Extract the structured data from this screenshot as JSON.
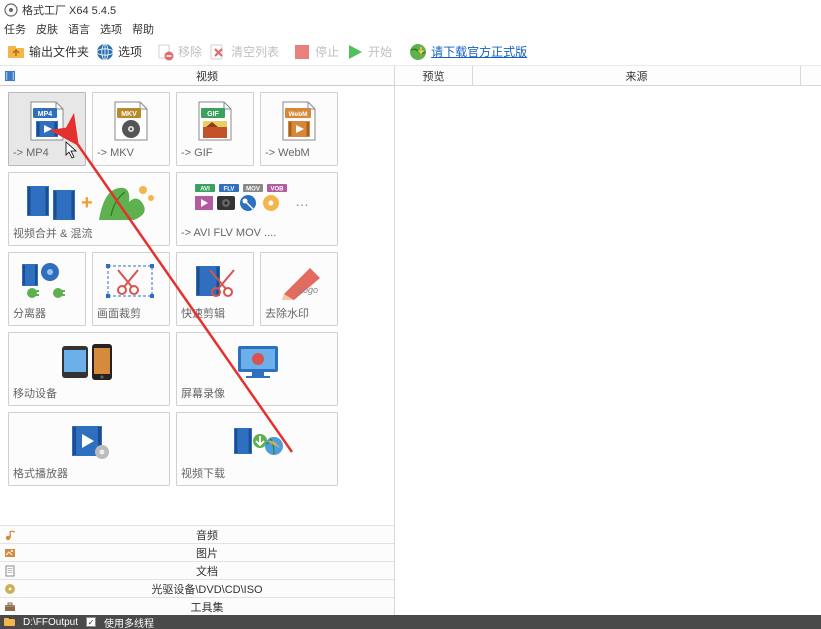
{
  "title": "格式工厂 X64 5.4.5",
  "menu": [
    "任务",
    "皮肤",
    "语言",
    "选项",
    "帮助"
  ],
  "toolbar": {
    "output_folder": "输出文件夹",
    "options": "选项",
    "remove": "移除",
    "clear_list": "清空列表",
    "stop": "停止",
    "start": "开始",
    "download_link": "请下载官方正式版"
  },
  "sections": {
    "video": "视频",
    "audio": "音频",
    "image": "图片",
    "document": "文档",
    "drive": "光驱设备\\DVD\\CD\\ISO",
    "tools": "工具集"
  },
  "tiles": {
    "mp4": "-> MP4",
    "mkv": "-> MKV",
    "gif": "-> GIF",
    "webm": "-> WebM",
    "merge": "视频合并 & 混流",
    "avi_etc": "-> AVI FLV MOV ....",
    "splitter": "分离器",
    "crop": "画面裁剪",
    "fast_clip": "快速剪辑",
    "watermark": "去除水印",
    "mobile": "移动设备",
    "screen_rec": "屏幕录像",
    "player": "格式播放器",
    "downloader": "视频下载"
  },
  "right_cols": {
    "preview": "预览",
    "source": "来源"
  },
  "status": {
    "path": "D:\\FFOutput",
    "multithread": "使用多线程"
  },
  "badges": {
    "mp4": "MP4",
    "mkv": "MKV",
    "gif": "GIF",
    "webm": "WebM",
    "avi": "AVI",
    "flv": "FLV",
    "mov": "MOV",
    "vob": "VOB",
    "logo": "Loġo"
  }
}
